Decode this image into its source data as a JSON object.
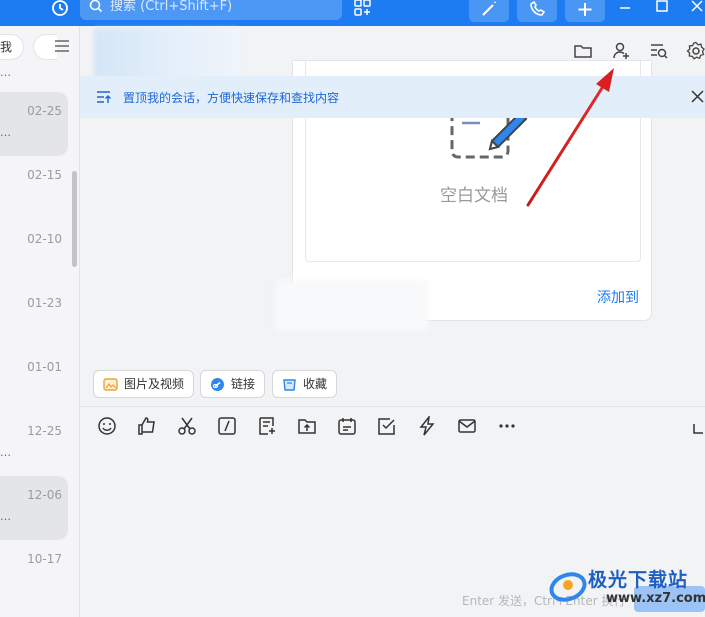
{
  "titlebar": {
    "search_placeholder": "搜索 (Ctrl+Shift+F)",
    "accent_color": "#1d7cf2",
    "icons": [
      "history-icon",
      "search-icon",
      "apps-icon",
      "magic-wand-icon",
      "phone-icon",
      "plus-icon",
      "minimize-icon",
      "maximize-icon",
      "close-icon"
    ]
  },
  "sidebar": {
    "tab_label": "我",
    "conversations": [
      {
        "date": "02-25",
        "selected": true
      },
      {
        "date": "02-15",
        "selected": false
      },
      {
        "date": "02-10",
        "selected": false
      },
      {
        "date": "01-23",
        "selected": false
      },
      {
        "date": "01-01",
        "selected": false
      },
      {
        "date": "12-25",
        "selected": false
      },
      {
        "date": "12-06",
        "selected": true
      },
      {
        "date": "10-17",
        "selected": false
      }
    ]
  },
  "header": {
    "icons": [
      "folder-icon",
      "add-member-icon",
      "search-history-icon",
      "settings-icon"
    ]
  },
  "banner": {
    "text": "置顶我的会话，方便快速保存和查找内容"
  },
  "card": {
    "doc_label": "空白文档",
    "add_label": "添加到"
  },
  "chips": {
    "media": "图片及视频",
    "link": "链接",
    "favorites": "收藏"
  },
  "toolbar": {
    "icons": [
      "emoji-icon",
      "like-icon",
      "scissors-icon",
      "slash-command-icon",
      "note-icon",
      "upload-icon",
      "calendar-icon",
      "task-icon",
      "lightning-icon",
      "mail-icon",
      "more-icon",
      "expand-icon"
    ]
  },
  "input": {
    "hint": "Enter 发送，Ctrl+Enter 换行"
  },
  "watermark": {
    "title": "极光下载站",
    "url": "www.xz7.com"
  }
}
